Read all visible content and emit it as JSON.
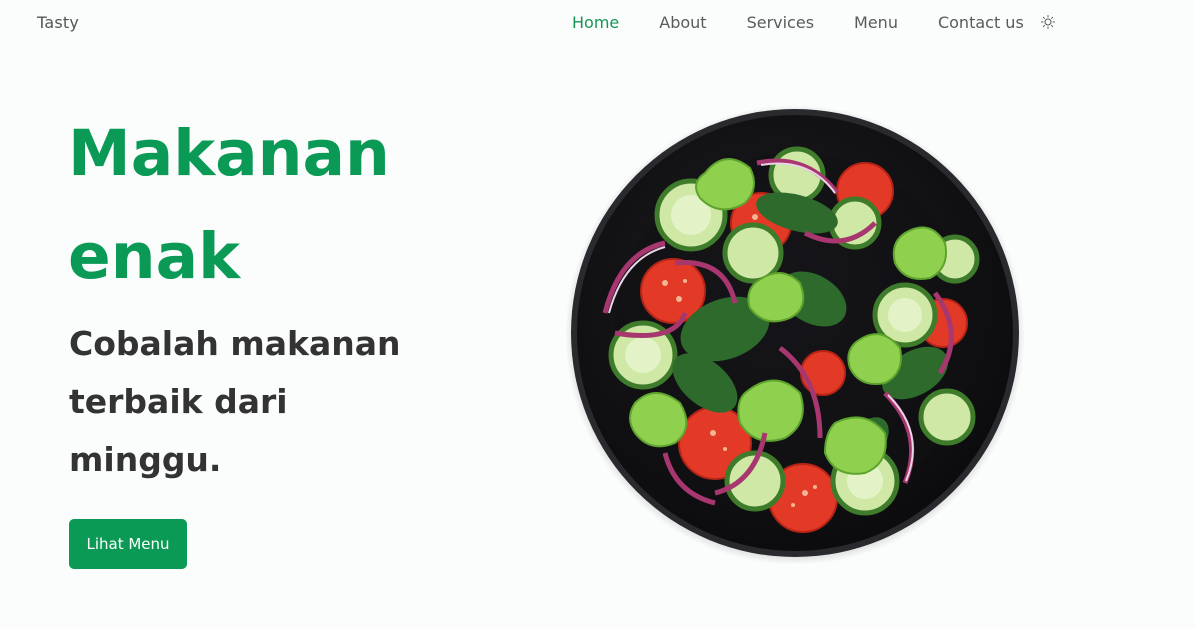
{
  "header": {
    "brand": "Tasty",
    "nav": [
      {
        "label": "Home",
        "active": true
      },
      {
        "label": "About",
        "active": false
      },
      {
        "label": "Services",
        "active": false
      },
      {
        "label": "Menu",
        "active": false
      },
      {
        "label": "Contact us",
        "active": false
      }
    ],
    "theme_toggle_icon": "sun-icon"
  },
  "hero": {
    "title_line1": "Makanan",
    "title_line2": "enak",
    "subtitle": "Cobalah makanan terbaik dari minggu.",
    "cta_label": "Lihat Menu"
  },
  "colors": {
    "accent": "#0a9a55",
    "text_dark": "#333333",
    "nav_text": "#5a5a5a",
    "background": "#fbfdfd"
  }
}
